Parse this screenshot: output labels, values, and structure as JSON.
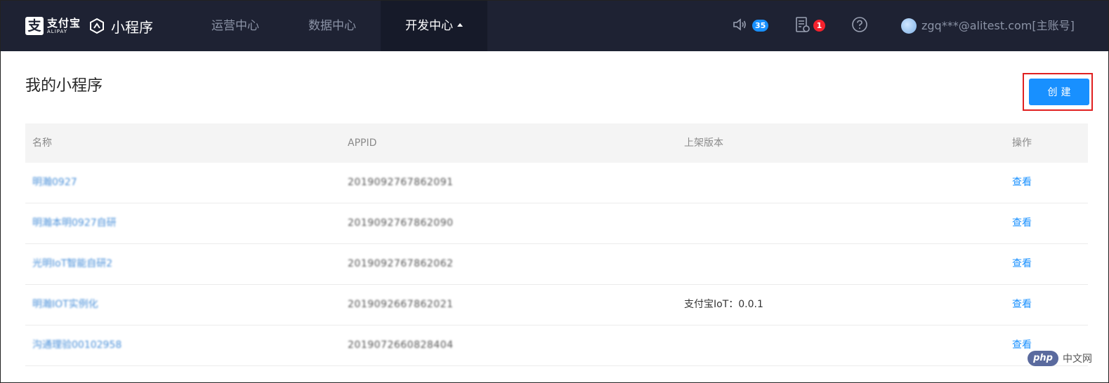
{
  "brand": {
    "alipay_zh": "支付宝",
    "alipay_en": "ALIPAY",
    "product": "小程序"
  },
  "nav": {
    "items": [
      {
        "label": "运营中心",
        "active": false
      },
      {
        "label": "数据中心",
        "active": false
      },
      {
        "label": "开发中心",
        "active": true
      }
    ]
  },
  "header_tools": {
    "notice_count": "35",
    "task_count": "1",
    "account": "zgq***@alitest.com[主账号]"
  },
  "page": {
    "title": "我的小程序",
    "create_label": "创建"
  },
  "table": {
    "columns": [
      "名称",
      "APPID",
      "上架版本",
      "操作"
    ],
    "rows": [
      {
        "name": "明瀚0927",
        "appid": "2019092767862091",
        "version": "",
        "action": "查看"
      },
      {
        "name": "明瀚本明0927自研",
        "appid": "2019092767862090",
        "version": "",
        "action": "查看"
      },
      {
        "name": "光明IoT智能自研2",
        "appid": "2019092767862062",
        "version": "",
        "action": "查看"
      },
      {
        "name": "明瀚IOT实例化",
        "appid": "2019092667862021",
        "version": "支付宝IoT：0.0.1",
        "action": "查看"
      },
      {
        "name": "沟通理验00102958",
        "appid": "2019072660828404",
        "version": "",
        "action": "查看"
      }
    ]
  },
  "watermark": {
    "logo": "php",
    "text": "中文网"
  },
  "colors": {
    "topbar": "#1e2233",
    "primary": "#1890ff",
    "badge_red": "#f5222d",
    "highlight_border": "#e02020"
  }
}
